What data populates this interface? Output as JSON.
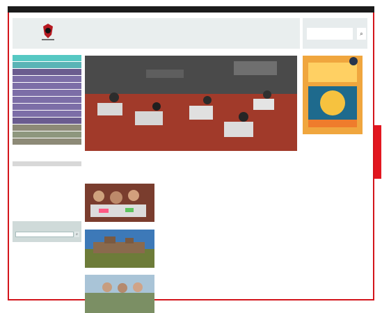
{
  "topbar": {
    "left_link": "",
    "right_links": [
      "",
      "",
      "",
      "",
      ""
    ]
  },
  "header": {
    "site_title": ""
  },
  "search": {
    "title": "",
    "placeholder": "",
    "button_icon": "search-icon"
  },
  "sidebar": {
    "items": [
      "",
      "",
      "",
      "",
      "",
      "",
      "",
      "",
      "",
      "",
      "",
      "",
      ""
    ]
  },
  "left_links": [
    "",
    "",
    "",
    "",
    "",
    "",
    ""
  ],
  "left_search": {
    "label": ""
  },
  "hero": {
    "caption": "",
    "intro": "",
    "read_more": ""
  },
  "news": [
    {
      "title": "",
      "desc": "",
      "more": ""
    },
    {
      "title": "",
      "desc": "",
      "more": ""
    },
    {
      "title": "",
      "desc": "",
      "more": ""
    }
  ],
  "right": {
    "caption_line1": "",
    "caption_line2": "",
    "caption_line3": ""
  },
  "colors": {
    "brand_red": "#d3141b",
    "topbar": "#1b1b1b",
    "teal": "#56c8c3",
    "purple": "#6a5c8f",
    "hero_bg": "#8d2e22"
  }
}
